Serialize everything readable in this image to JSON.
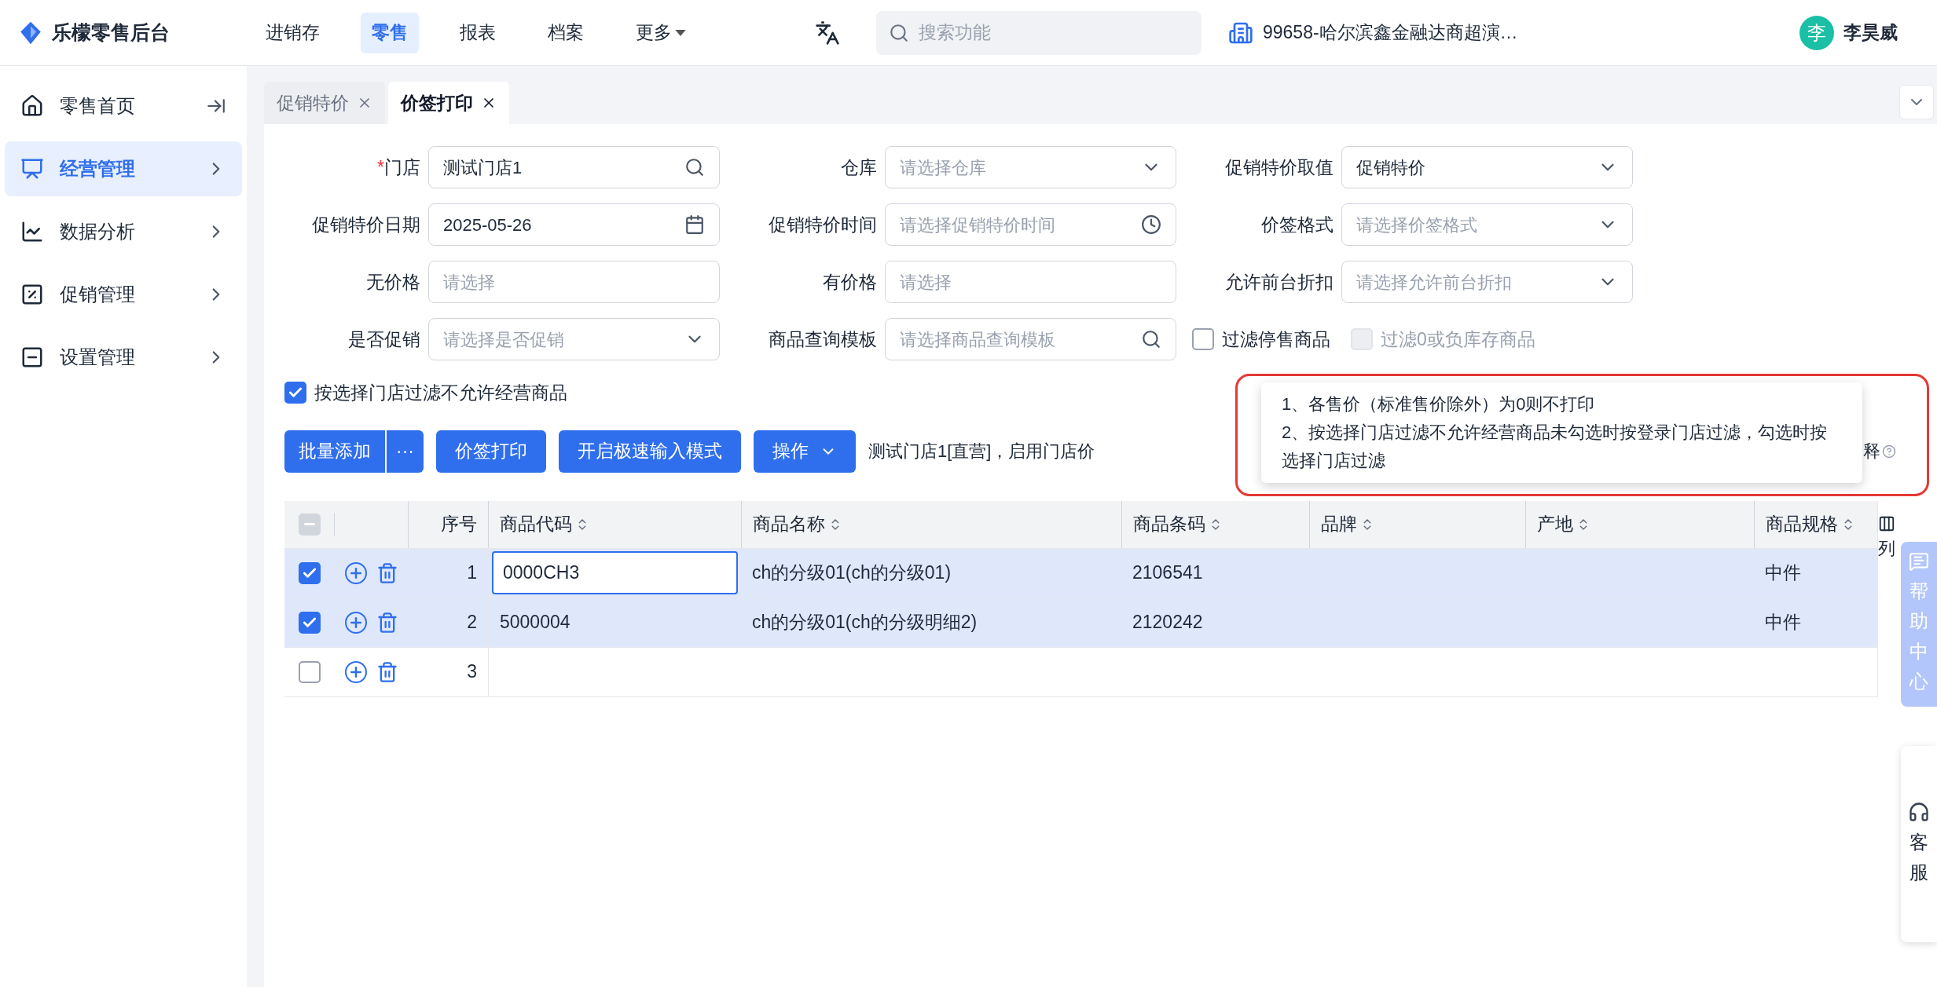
{
  "app": {
    "name": "乐檬零售后台"
  },
  "nav": [
    {
      "label": "进销存",
      "selected": false,
      "dropdown": false
    },
    {
      "label": "零售",
      "selected": true,
      "dropdown": false
    },
    {
      "label": "报表",
      "selected": false,
      "dropdown": false
    },
    {
      "label": "档案",
      "selected": false,
      "dropdown": false
    },
    {
      "label": "更多",
      "selected": false,
      "dropdown": true
    }
  ],
  "search": {
    "placeholder": "搜索功能"
  },
  "store": "99658-哈尔滨鑫金融达商超演…",
  "user": {
    "avatar": "李",
    "name": "李昊威"
  },
  "sidebar": {
    "items": [
      {
        "label": "零售首页",
        "selected": false,
        "kind": "link"
      },
      {
        "label": "经营管理",
        "selected": true,
        "kind": "group"
      },
      {
        "label": "数据分析",
        "selected": false,
        "kind": "group"
      },
      {
        "label": "促销管理",
        "selected": false,
        "kind": "group"
      },
      {
        "label": "设置管理",
        "selected": false,
        "kind": "group"
      }
    ]
  },
  "tabs": [
    {
      "label": "促销特价",
      "selected": false
    },
    {
      "label": "价签打印",
      "selected": true
    }
  ],
  "form": [
    {
      "label": "门店",
      "required_mark": "*",
      "kind": "search",
      "value": "测试门店1"
    },
    {
      "label": "仓库",
      "kind": "select",
      "placeholder": "请选择仓库"
    },
    {
      "label": "促销特价取值",
      "kind": "select",
      "value": "促销特价"
    },
    {
      "label": "促销特价日期",
      "kind": "date",
      "value": "2025-05-26"
    },
    {
      "label": "促销特价时间",
      "kind": "time",
      "placeholder": "请选择促销特价时间"
    },
    {
      "label": "价签格式",
      "kind": "select",
      "placeholder": "请选择价签格式"
    },
    {
      "label": "无价格",
      "kind": "text",
      "placeholder": "请选择"
    },
    {
      "label": "有价格",
      "kind": "text",
      "placeholder": "请选择"
    },
    {
      "label": "允许前台折扣",
      "kind": "select",
      "placeholder": "请选择允许前台折扣"
    },
    {
      "label": "是否促销",
      "kind": "select",
      "placeholder": "请选择是否促销"
    },
    {
      "label": "商品查询模板",
      "kind": "search",
      "placeholder": "请选择商品查询模板"
    },
    {
      "kind": "checkboxes",
      "options": [
        {
          "label": "过滤停售商品",
          "checked": false,
          "disabled": false
        },
        {
          "label": "过滤0或负库存商品",
          "checked": false,
          "disabled": true
        }
      ]
    }
  ],
  "filter": {
    "label": "按选择门店过滤不允许经营商品",
    "checked": true
  },
  "toolbar": {
    "buttons": [
      {
        "label": "批量添加",
        "kind": "split",
        "more": "···"
      },
      {
        "label": "价签打印",
        "kind": "plain"
      },
      {
        "label": "开启极速输入模式",
        "kind": "plain"
      },
      {
        "label": "操作",
        "kind": "dropdown"
      }
    ],
    "info": "测试门店1[直营]，启用门店价",
    "info_suffix": "释"
  },
  "tooltip": {
    "lines": [
      "1、各售价（标准售价除外）为0则不打印",
      "2、按选择门店过滤不允许经营商品未勾选时按登录门店过滤，勾选时按选择门店过滤"
    ]
  },
  "table": {
    "select_all": {
      "indeterminate": true
    },
    "columns": [
      {
        "label": "序号",
        "sortable": false
      },
      {
        "label": "商品代码",
        "sortable": true
      },
      {
        "label": "商品名称",
        "sortable": true
      },
      {
        "label": "商品条码",
        "sortable": true
      },
      {
        "label": "品牌",
        "sortable": true
      },
      {
        "label": "产地",
        "sortable": true
      },
      {
        "label": "商品规格",
        "sortable": true
      }
    ],
    "rows": [
      {
        "checked": true,
        "editing": true,
        "cells": [
          "1",
          "0000CH3",
          "ch的分级01(ch的分级01)",
          "2106541",
          null,
          null,
          "中件"
        ]
      },
      {
        "checked": true,
        "editing": false,
        "cells": [
          "2",
          "5000004",
          "ch的分级01(ch的分级明细2)",
          "2120242",
          null,
          null,
          "中件"
        ]
      },
      {
        "checked": false,
        "editing": false,
        "cells": [
          "3",
          null,
          null,
          null,
          null,
          null,
          null
        ]
      }
    ],
    "column_settings": "列"
  },
  "float": {
    "help": "帮助中心",
    "service": "客服"
  }
}
